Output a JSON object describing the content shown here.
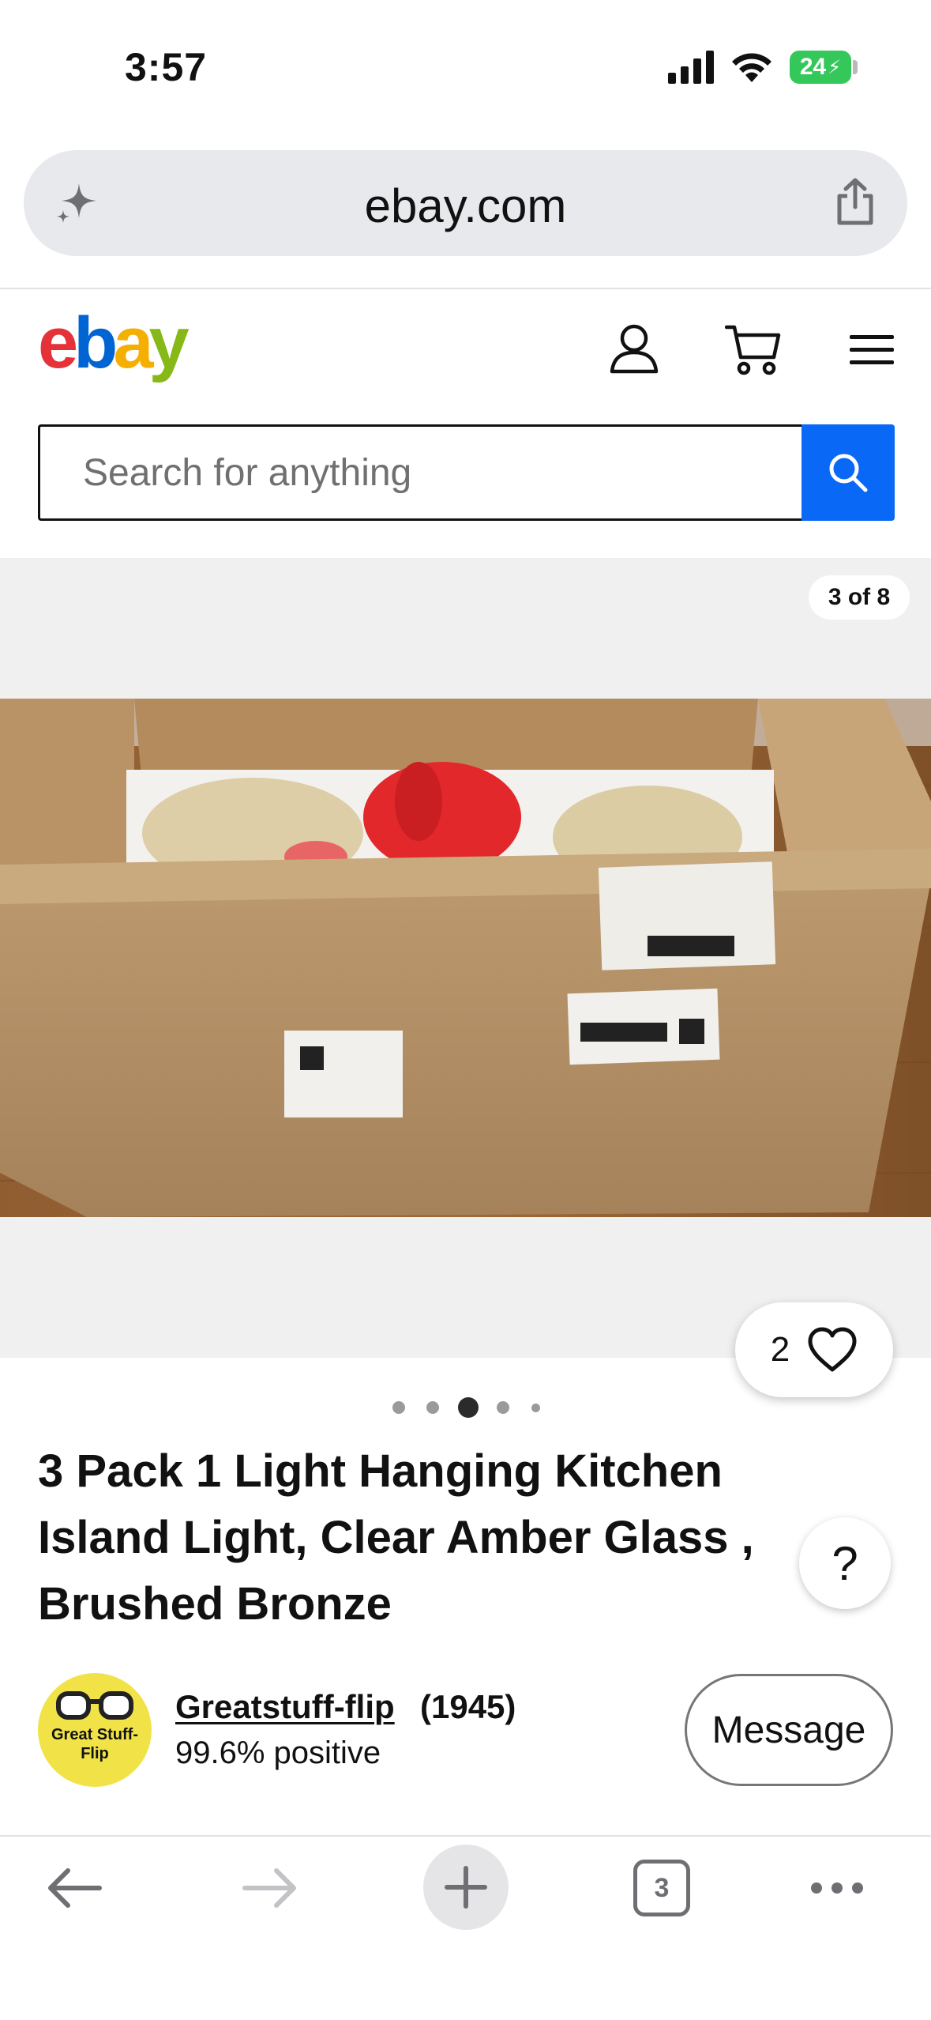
{
  "status_bar": {
    "time": "3:57",
    "battery": "24"
  },
  "browser": {
    "url": "ebay.com",
    "tab_count": "3"
  },
  "header": {
    "logo_letters": [
      "e",
      "b",
      "a",
      "y"
    ],
    "logo_colors": [
      "#e53238",
      "#0064d2",
      "#f5af02",
      "#86b817"
    ],
    "search_placeholder": "Search for anything",
    "search_button_color": "#0968f6"
  },
  "gallery": {
    "counter": "3 of 8",
    "total_dots": 5,
    "active_dot": 2,
    "watch_count": "2"
  },
  "product": {
    "title": "3 Pack 1 Light Hanging Kitchen Island Light, Clear Amber Glass , Brushed Bronze"
  },
  "seller": {
    "avatar_text": "Great Stuff-Flip",
    "name": "Greatstuff-flip",
    "feedback_count": "(1945)",
    "positive": "99.6% positive",
    "message_label": "Message"
  },
  "icons": {
    "url_left": "sparkle-icon",
    "url_right": "share-icon",
    "header": [
      "user-icon",
      "cart-icon",
      "menu-icon"
    ],
    "toolbar": [
      "back-arrow-icon",
      "forward-arrow-icon",
      "plus-icon",
      "tabs-icon",
      "more-icon"
    ]
  }
}
